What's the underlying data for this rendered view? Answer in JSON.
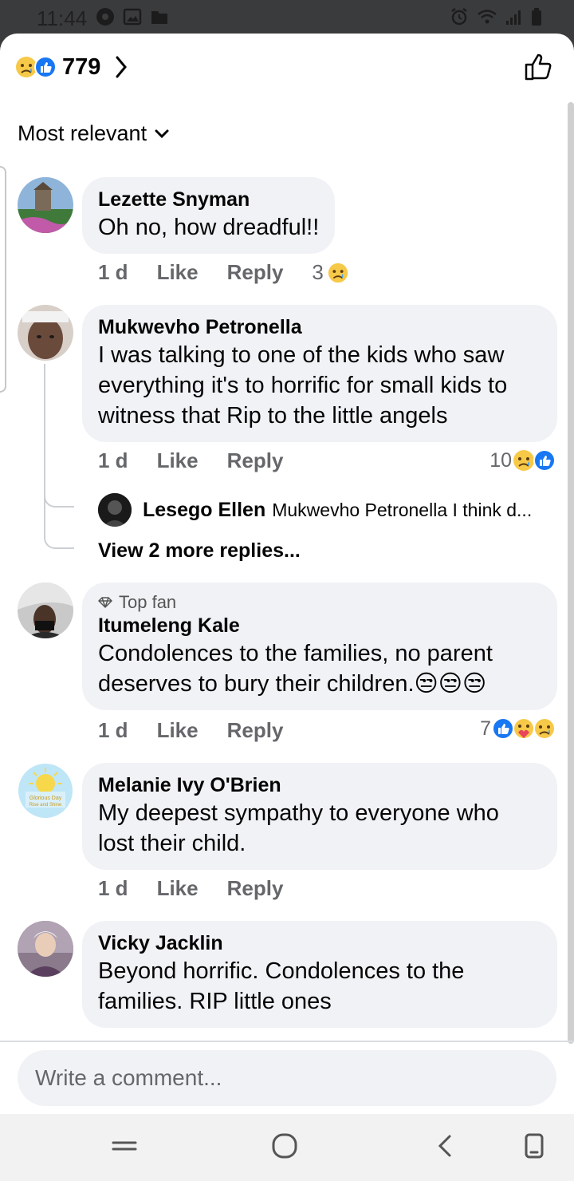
{
  "status_bar": {
    "time": "11:44"
  },
  "header": {
    "reaction_count": "779"
  },
  "sort": {
    "label": "Most relevant"
  },
  "comments": [
    {
      "author": "Lezette Snyman",
      "text": "Oh no, how dreadful!!",
      "time": "1 d",
      "like": "Like",
      "reply": "Reply",
      "reaction_count": "3"
    },
    {
      "author": "Mukwevho Petronella",
      "text": "I was talking to one of the kids who saw everything it's to horrific for small kids to witness that Rip to the little angels",
      "time": "1 d",
      "like": "Like",
      "reply": "Reply",
      "reaction_count": "10"
    },
    {
      "badge": "Top fan",
      "author": "Itumeleng Kale",
      "text": "Condolences to the families, no parent deserves to bury their children.😒😒😒",
      "time": "1 d",
      "like": "Like",
      "reply": "Reply",
      "reaction_count": "7"
    },
    {
      "author": "Melanie Ivy O'Brien",
      "text": "My deepest sympathy to everyone who lost their child.",
      "time": "1 d",
      "like": "Like",
      "reply": "Reply"
    },
    {
      "author": "Vicky Jacklin",
      "text": "Beyond horrific. Condolences to the families. RIP little ones"
    }
  ],
  "reply_preview": {
    "author": "Lesego Ellen",
    "text": "Mukwevho Petronella I think d..."
  },
  "view_more": "View 2 more replies...",
  "composer": {
    "placeholder": "Write a comment..."
  },
  "colors": {
    "like_blue": "#1877f2",
    "sad_yellow": "#f7b125",
    "bubble_bg": "#f0f2f5",
    "meta_gray": "#65676b"
  },
  "icons": [
    "photo-icon",
    "folder-icon",
    "alarm-icon",
    "wifi-icon",
    "signal-icon",
    "battery-icon",
    "sad-reaction-icon",
    "like-reaction-icon",
    "care-reaction-icon",
    "chevron-right-icon",
    "chevron-down-icon",
    "thumbs-up-outline-icon",
    "diamond-icon"
  ]
}
